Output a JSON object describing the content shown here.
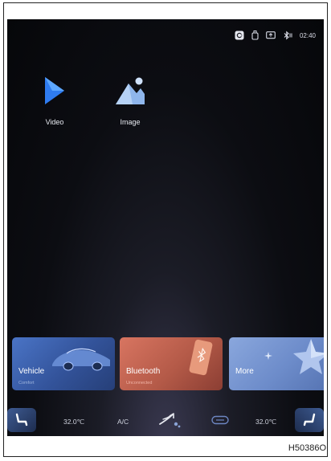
{
  "status_bar": {
    "icons": [
      "apple-carplay-icon",
      "usb-icon",
      "screen-mirror-icon",
      "bluetooth-icon"
    ],
    "time": "02:40"
  },
  "apps": [
    {
      "label": "Video",
      "icon": "video-play-icon",
      "color": "#2f7cf0"
    },
    {
      "label": "Image",
      "icon": "image-gallery-icon",
      "color": "#8fb6ec"
    }
  ],
  "cards": [
    {
      "title": "Vehicle",
      "subtitle": "Comfort"
    },
    {
      "title": "Bluetooth",
      "subtitle": "Unconnected"
    },
    {
      "title": "More"
    }
  ],
  "climate_bar": {
    "left_temp": "32.0℃",
    "ac_label": "A/C",
    "right_temp": "32.0℃"
  },
  "figure_code": "H50386O"
}
